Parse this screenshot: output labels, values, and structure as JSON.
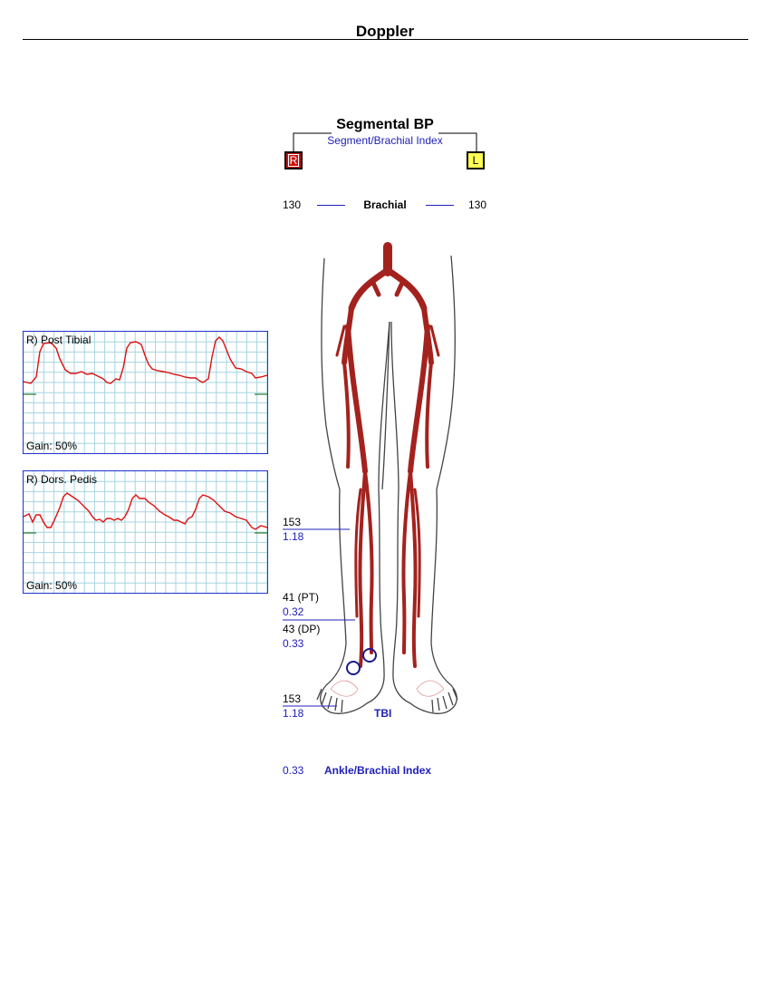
{
  "header": {
    "title": "Doppler"
  },
  "segmental": {
    "title": "Segmental BP",
    "subtitle": "Segment/Brachial Index",
    "right_label": "R",
    "left_label": "L",
    "brachial_label": "Brachial",
    "brachial_right": "130",
    "brachial_left": "130"
  },
  "measurements": {
    "calf_pressure": "153",
    "calf_index": "1.18",
    "pt_pressure": "41 (PT)",
    "pt_index": "0.32",
    "dp_pressure": "43 (DP)",
    "dp_index": "0.33",
    "toe_pressure": "153",
    "toe_index": "1.18",
    "tbi_label": "TBI",
    "abi_value": "0.33",
    "abi_label": "Ankle/Brachial Index"
  },
  "waveforms": [
    {
      "label": "R) Post Tibial",
      "gain": "Gain: 50%"
    },
    {
      "label": "R) Dors. Pedis",
      "gain": "Gain: 50%"
    }
  ],
  "colors": {
    "accent_blue": "#2020b8",
    "artery_red": "#a3221e",
    "wave_red": "#e01010",
    "grid": "#a6d5e0",
    "baseline_green": "#2a7a2a",
    "right_box": "#cc1111",
    "left_box": "#ffff55"
  }
}
